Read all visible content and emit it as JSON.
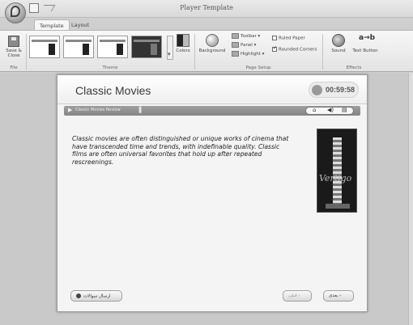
{
  "window": {
    "title": "Player Template"
  },
  "tabs": [
    {
      "label": "Template"
    },
    {
      "label": "Layout"
    }
  ],
  "ribbon": {
    "save": {
      "label": "Save & Close",
      "group": "File"
    },
    "theme": {
      "group": "Theme",
      "colors_label": "Colors"
    },
    "page_setup": {
      "group": "Page Setup",
      "background_label": "Background",
      "toolbar_label": "Toolbar",
      "panel_label": "Panel",
      "highlight_label": "Highlight",
      "ruled_paper_label": "Ruled Paper",
      "ruled_paper_checked": false,
      "rounded_corners_label": "Rounded Corners",
      "rounded_corners_checked": true
    },
    "effects": {
      "group": "Effects",
      "sound_label": "Sound",
      "text_label": "Text Button"
    }
  },
  "slide": {
    "title": "Classic Movies",
    "timer": "00:59:58",
    "breadcrumb": "Classic Movies Review",
    "body": "Classic movies are often distinguished or unique works of cinema that have transcended time and trends, with indefinable quality. Classic films are often universal favorites that hold up after repeated rescreenings.",
    "poster_text": "Vertigo",
    "footer": {
      "left_button": "ارسال سوالات",
      "prev_button": "قبلی",
      "next_button": "بعدی"
    }
  },
  "icons": [
    "app-orb-icon",
    "save-icon",
    "colors-icon",
    "background-icon",
    "sound-icon",
    "text-button-icon",
    "home-icon",
    "volume-icon",
    "print-icon"
  ]
}
